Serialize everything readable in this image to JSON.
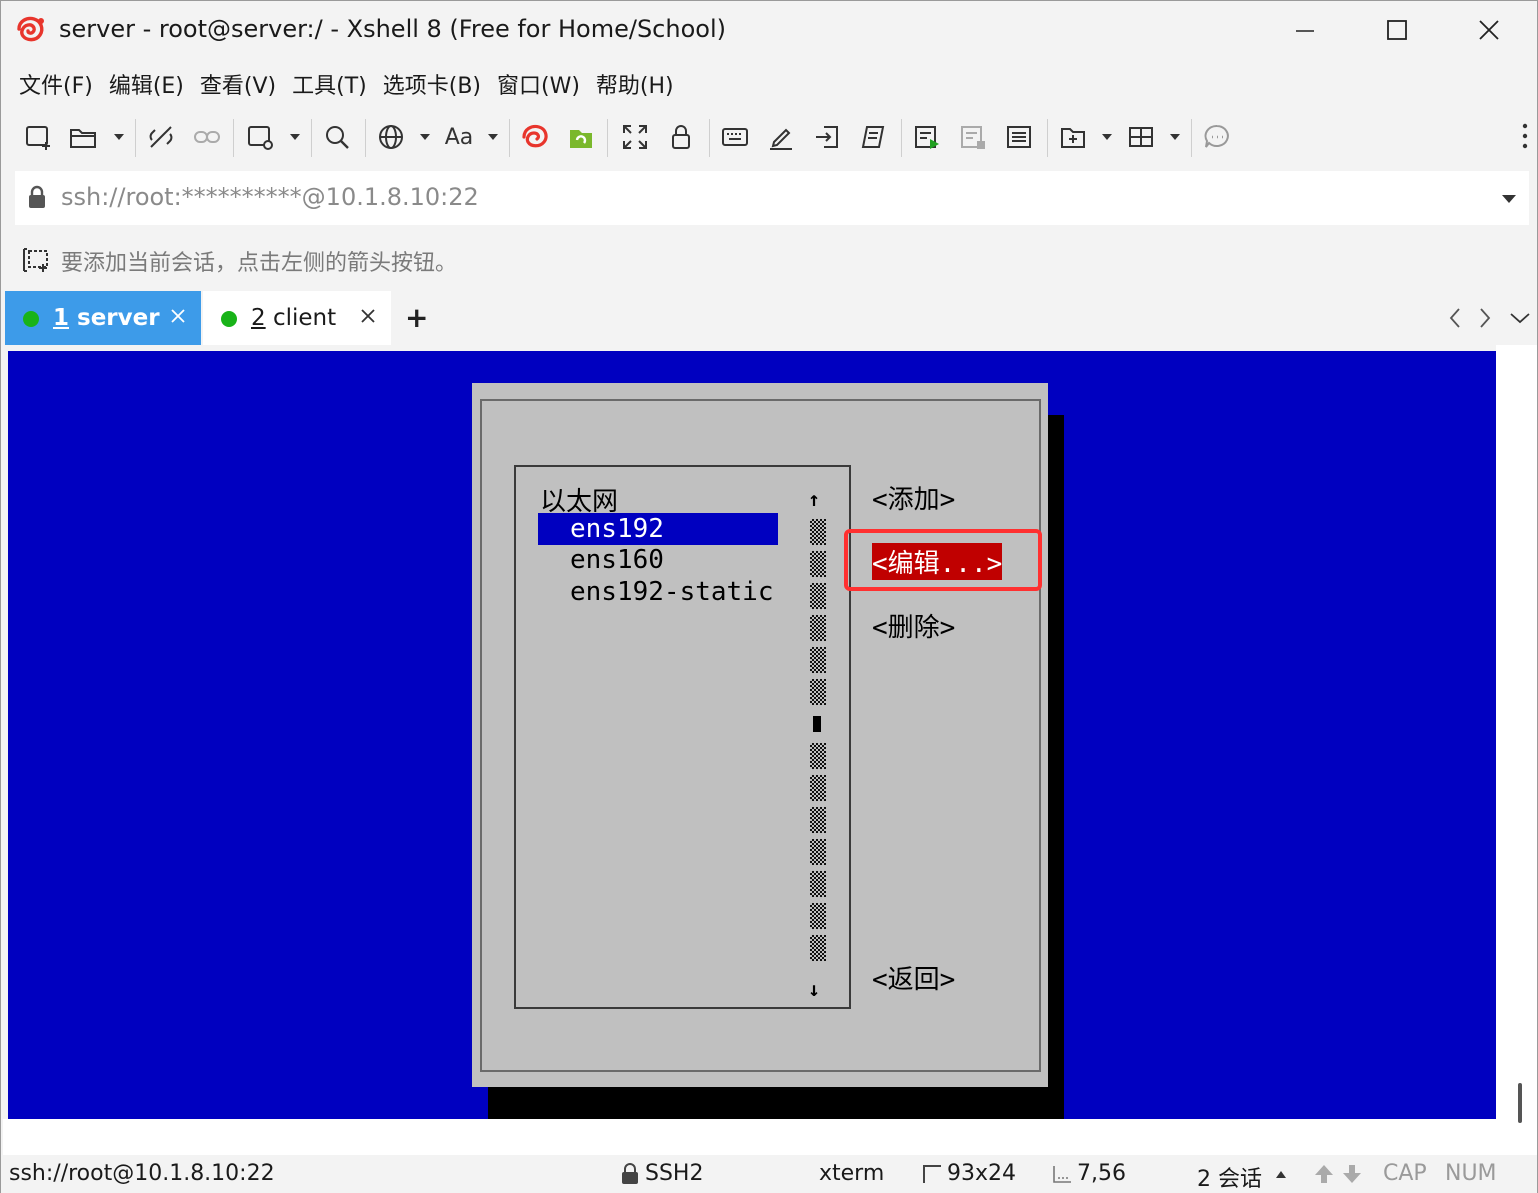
{
  "window": {
    "title": "server - root@server:/ - Xshell 8 (Free for Home/School)"
  },
  "menu": [
    "文件(F)",
    "编辑(E)",
    "查看(V)",
    "工具(T)",
    "选项卡(B)",
    "窗口(W)",
    "帮助(H)"
  ],
  "toolbar": {
    "font_label": "Aa"
  },
  "address": {
    "value": "ssh://root:**********@10.1.8.10:22"
  },
  "hint": {
    "text": "要添加当前会话，点击左侧的箭头按钮。"
  },
  "tabs": [
    {
      "num": "1",
      "label": " server",
      "status_color": "#19b319",
      "active": true
    },
    {
      "num": "2",
      "label": " client",
      "status_color": "#19b319",
      "active": false
    }
  ],
  "tab_add_label": "+",
  "terminal": {
    "list_heading": "以太网",
    "connections": [
      "ens192",
      "ens160",
      "ens192-static"
    ],
    "selected_connection": "ens192",
    "scroll_up": "↑",
    "scroll_down": "↓",
    "buttons": {
      "add": "<添加>",
      "edit": "<编辑...>",
      "delete": "<删除>",
      "back": "<返回>"
    },
    "colors": {
      "background": "#0000c0",
      "dialog": "#c0c0c0",
      "selected_button": "#c00000",
      "highlight_frame": "#ff3030"
    }
  },
  "status": {
    "connection": "ssh://root@10.1.8.10:22",
    "protocol": "SSH2",
    "terminal_type": "xterm",
    "size": "93x24",
    "cursor": "7,56",
    "sessions": "2 会话",
    "cap": "CAP",
    "num": "NUM"
  }
}
